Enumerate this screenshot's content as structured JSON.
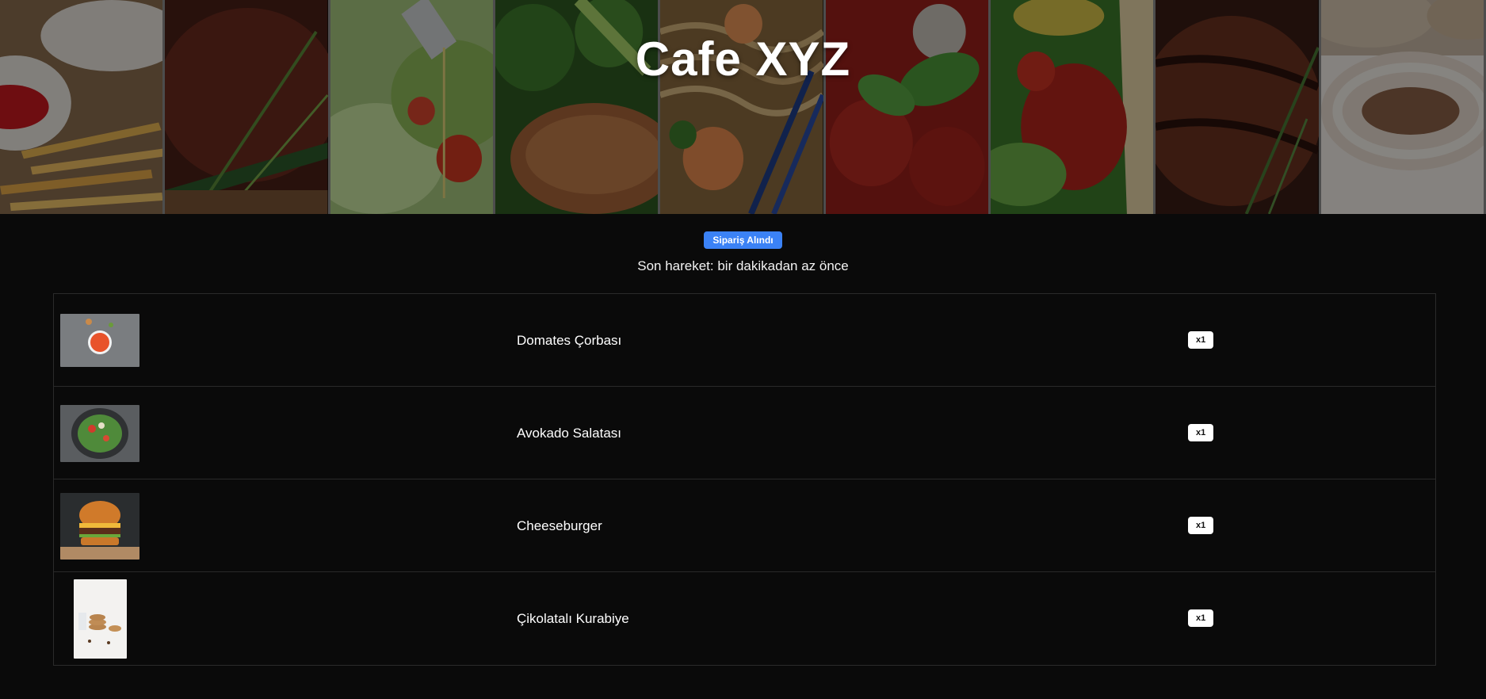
{
  "header": {
    "title": "Cafe XYZ",
    "panels": [
      "fries-with-ketchup",
      "grilled-steak",
      "salad-with-oil",
      "broccoli-and-meat",
      "shrimp-noodles",
      "tomato-basil-sauce",
      "taco",
      "grilled-meat-rosemary",
      "cappuccino"
    ]
  },
  "status": {
    "badge": "Sipariş Alındı",
    "last_activity": "Son hareket: bir dakikadan az önce",
    "badge_color": "#3b82f6"
  },
  "order": {
    "items": [
      {
        "name": "Domates Çorbası",
        "qty": "x1",
        "image": "tomato-soup"
      },
      {
        "name": "Avokado Salatası",
        "qty": "x1",
        "image": "avocado-salad"
      },
      {
        "name": "Cheeseburger",
        "qty": "x1",
        "image": "cheeseburger"
      },
      {
        "name": "Çikolatalı Kurabiye",
        "qty": "x1",
        "image": "chocolate-cookies"
      }
    ]
  }
}
